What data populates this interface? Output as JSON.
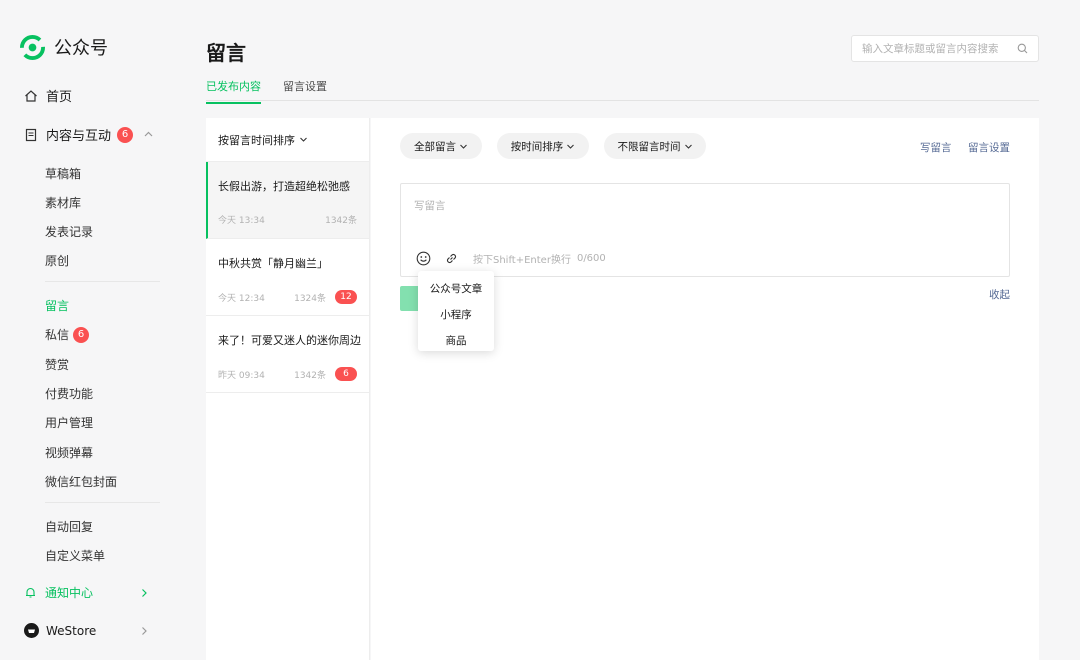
{
  "app": {
    "name": "公众号"
  },
  "sidebar": {
    "home": "首页",
    "content": {
      "label": "内容与互动",
      "badge": "6"
    },
    "content_items": [
      {
        "label": "草稿箱"
      },
      {
        "label": "素材库"
      },
      {
        "label": "发表记录"
      },
      {
        "label": "原创"
      }
    ],
    "interact_items": [
      {
        "label": "留言"
      },
      {
        "label": "私信",
        "badge": "6"
      },
      {
        "label": "赞赏"
      },
      {
        "label": "付费功能"
      },
      {
        "label": "用户管理"
      },
      {
        "label": "视频弹幕"
      },
      {
        "label": "微信红包封面"
      }
    ],
    "other_items": [
      {
        "label": "自动回复"
      },
      {
        "label": "自定义菜单"
      }
    ],
    "notice": "通知中心",
    "westore": "WeStore"
  },
  "header": {
    "title": "留言",
    "search_placeholder": "输入文章标题或留言内容搜索"
  },
  "tabs": [
    {
      "label": "已发布内容"
    },
    {
      "label": "留言设置"
    }
  ],
  "list": {
    "sort_label": "按留言时间排序",
    "articles": [
      {
        "title": "长假出游，打造超绝松弛感",
        "time": "今天 13:34",
        "count": "1342条",
        "badge": ""
      },
      {
        "title": "中秋共赏「静月幽兰」",
        "time": "今天 12:34",
        "count": "1324条",
        "badge": "12"
      },
      {
        "title": "来了！可爱又迷人的迷你周边",
        "time": "昨天 09:34",
        "count": "1342条",
        "badge": "6"
      }
    ]
  },
  "filters": {
    "all": "全部留言",
    "sort": "按时间排序",
    "time": "不限留言时间"
  },
  "actions": {
    "write": "写留言",
    "settings": "留言设置"
  },
  "editor": {
    "placeholder": "写留言",
    "hint": "按下Shift+Enter换行",
    "counter": "0/600",
    "collapse": "收起"
  },
  "popover": {
    "items": [
      "公众号文章",
      "小程序",
      "商品"
    ]
  },
  "colors": {
    "accent": "#07c160",
    "badge": "#fa5151",
    "link": "#576b95"
  }
}
